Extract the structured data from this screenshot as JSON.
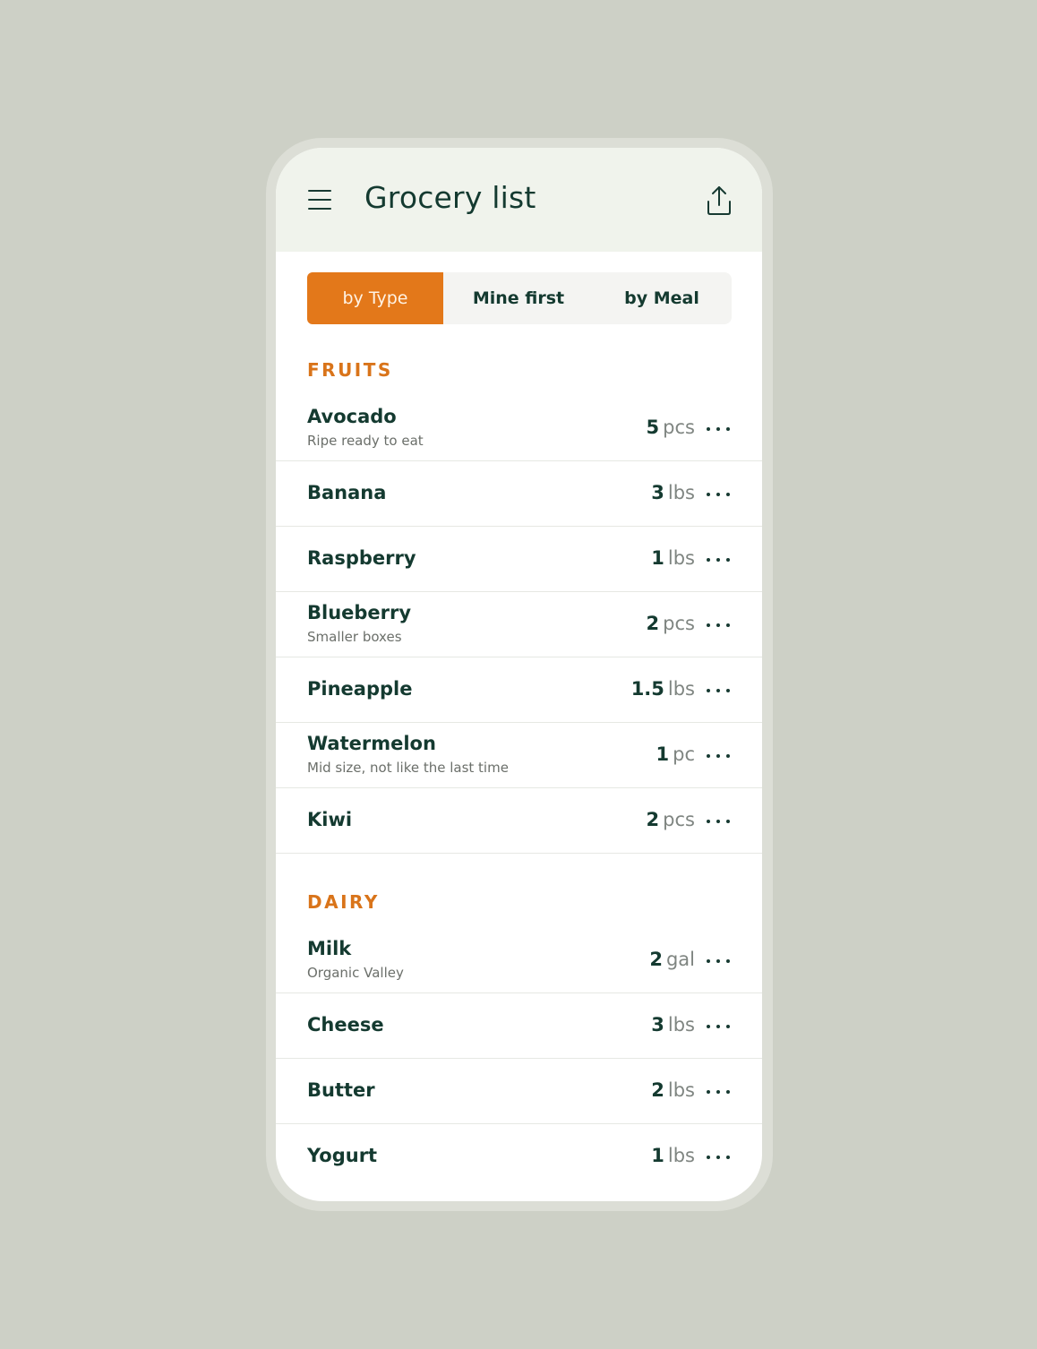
{
  "app": {
    "title": "Grocery list"
  },
  "tabs": [
    {
      "label": "by Type",
      "active": true
    },
    {
      "label": "Mine first",
      "active": false
    },
    {
      "label": "by Meal",
      "active": false
    }
  ],
  "sections": [
    {
      "title": "FRUITS",
      "items": [
        {
          "name": "Avocado",
          "note": "Ripe ready to eat",
          "qty": "5",
          "unit": "pcs"
        },
        {
          "name": "Banana",
          "note": "",
          "qty": "3",
          "unit": "lbs"
        },
        {
          "name": "Raspberry",
          "note": "",
          "qty": "1",
          "unit": "lbs"
        },
        {
          "name": "Blueberry",
          "note": "Smaller boxes",
          "qty": "2",
          "unit": "pcs"
        },
        {
          "name": "Pineapple",
          "note": "",
          "qty": "1.5",
          "unit": "lbs"
        },
        {
          "name": "Watermelon",
          "note": "Mid size, not like the last time",
          "qty": "1",
          "unit": "pc"
        },
        {
          "name": "Kiwi",
          "note": "",
          "qty": "2",
          "unit": "pcs"
        }
      ]
    },
    {
      "title": "DAIRY",
      "items": [
        {
          "name": "Milk",
          "note": "Organic Valley",
          "qty": "2",
          "unit": "gal"
        },
        {
          "name": "Cheese",
          "note": "",
          "qty": "3",
          "unit": "lbs"
        },
        {
          "name": "Butter",
          "note": "",
          "qty": "2",
          "unit": "lbs"
        },
        {
          "name": "Yogurt",
          "note": "",
          "qty": "1",
          "unit": "lbs"
        }
      ]
    }
  ],
  "icons": {
    "menu": "menu-icon",
    "share": "share-icon",
    "more": "more-options-icon"
  },
  "colors": {
    "accent": "#e3781a",
    "primary_text": "#143a30",
    "header_bg": "#f0f3ec",
    "background": "#cdd0c6"
  }
}
